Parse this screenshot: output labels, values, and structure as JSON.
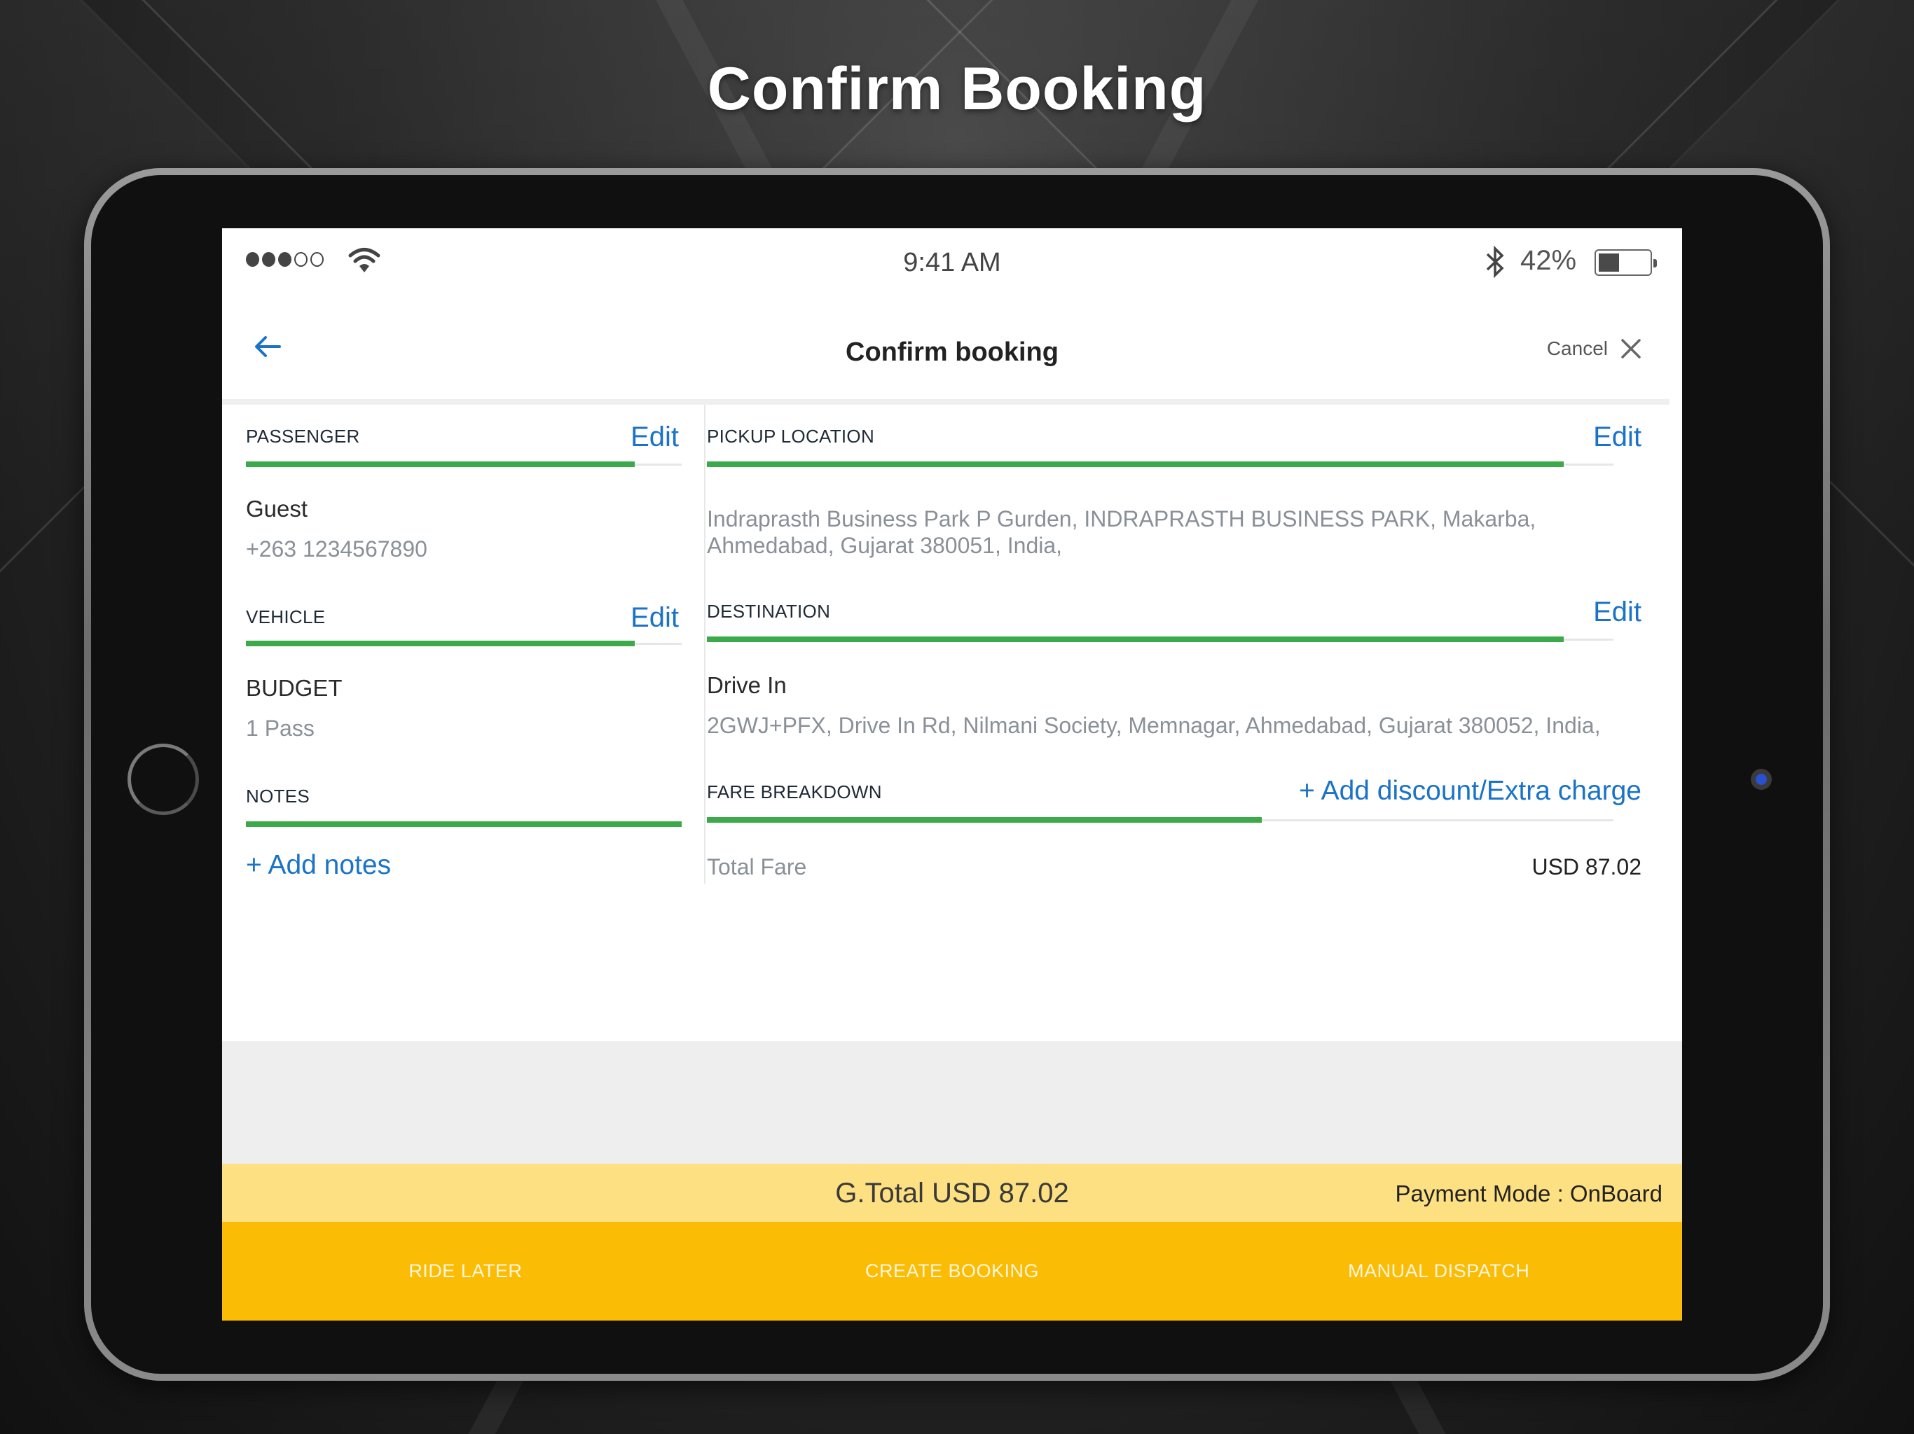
{
  "promo": {
    "title": "Confirm Booking"
  },
  "status_bar": {
    "signal_bars_filled": 3,
    "signal_bars_total": 5,
    "wifi_icon": "wifi-icon",
    "time": "9:41 AM",
    "bluetooth_icon": "bluetooth-icon",
    "battery_percent_label": "42%",
    "battery_level": 0.42
  },
  "nav": {
    "back_icon": "arrow-left-icon",
    "title": "Confirm booking",
    "cancel_label": "Cancel",
    "close_icon": "close-icon"
  },
  "passenger": {
    "heading": "PASSENGER",
    "edit_label": "Edit",
    "name": "Guest",
    "phone": "+263 1234567890"
  },
  "vehicle": {
    "heading": "VEHICLE",
    "edit_label": "Edit",
    "type": "BUDGET",
    "capacity": "1 Pass"
  },
  "notes": {
    "heading": "NOTES",
    "add_label": "+ Add notes"
  },
  "pickup": {
    "heading": "PICKUP LOCATION",
    "edit_label": "Edit",
    "address_line1": "Indraprasth Business Park P Gurden, INDRAPRASTH BUSINESS PARK, Makarba,",
    "address_line2": "Ahmedabad, Gujarat 380051, India,"
  },
  "destination": {
    "heading": "DESTINATION",
    "edit_label": "Edit",
    "name": "Drive In",
    "address": "2GWJ+PFX, Drive In Rd, Nilmani Society, Memnagar, Ahmedabad, Gujarat 380052, India,"
  },
  "fare": {
    "heading": "FARE BREAKDOWN",
    "add_label": "+ Add discount/Extra charge",
    "rows": [
      {
        "label": "Total Fare",
        "value": "USD 87.02"
      }
    ]
  },
  "summary": {
    "grand_total": "G.Total USD 87.02",
    "payment_mode": "Payment Mode : OnBoard"
  },
  "actions": [
    {
      "label": "RIDE LATER"
    },
    {
      "label": "CREATE BOOKING"
    },
    {
      "label": "MANUAL DISPATCH"
    }
  ],
  "colors": {
    "accent_blue": "#1a73c8",
    "progress_green": "#3caa4a",
    "summary_yellow": "#fde082",
    "action_yellow": "#fbbc05"
  }
}
